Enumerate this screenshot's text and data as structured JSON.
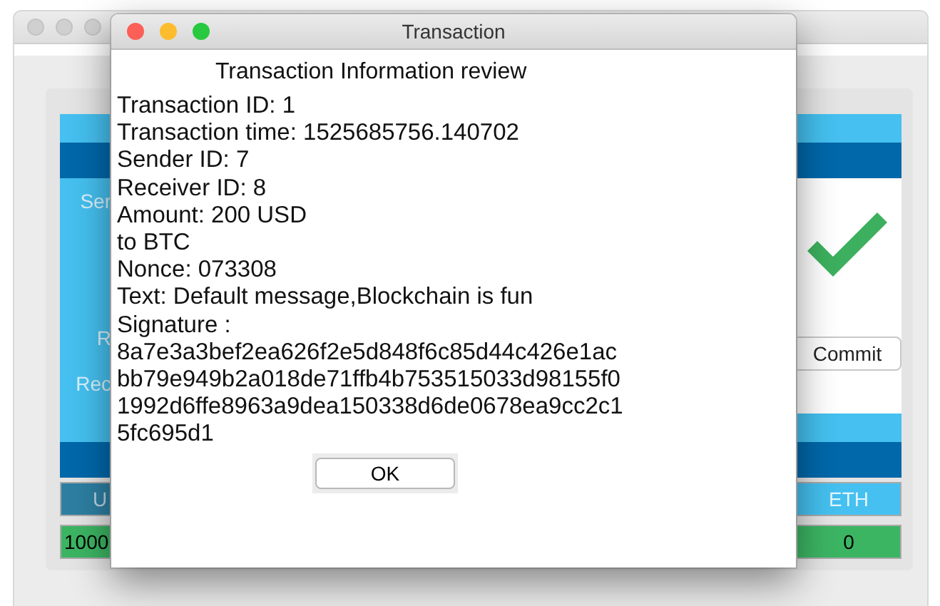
{
  "background_window": {
    "side_labels": [
      "Ser",
      "R",
      "Rec"
    ],
    "commit_button": "Commit",
    "table": {
      "columns": [
        "U",
        "ETH"
      ],
      "rows": [
        [
          "1000",
          "0"
        ]
      ]
    }
  },
  "dialog": {
    "title": "Transaction",
    "heading": "Transaction Information review",
    "lines": [
      "Transaction ID: 1",
      "Transaction time: 1525685756.140702",
      "Sender ID: 7",
      "Receiver ID: 8",
      "Amount: 200 USD",
      "to BTC",
      "Nonce: 073308",
      "Text: Default message,Blockchain is fun",
      "Signature :",
      "8a7e3a3bef2ea626f2e5d848f6c85d44c426e1ac",
      "bb79e949b2a018de71ffb4b753515033d98155f0",
      "1992d6ffe8963a9dea150338d6de0678ea9cc2c1",
      "5fc695d1"
    ],
    "ok_button": "OK"
  }
}
